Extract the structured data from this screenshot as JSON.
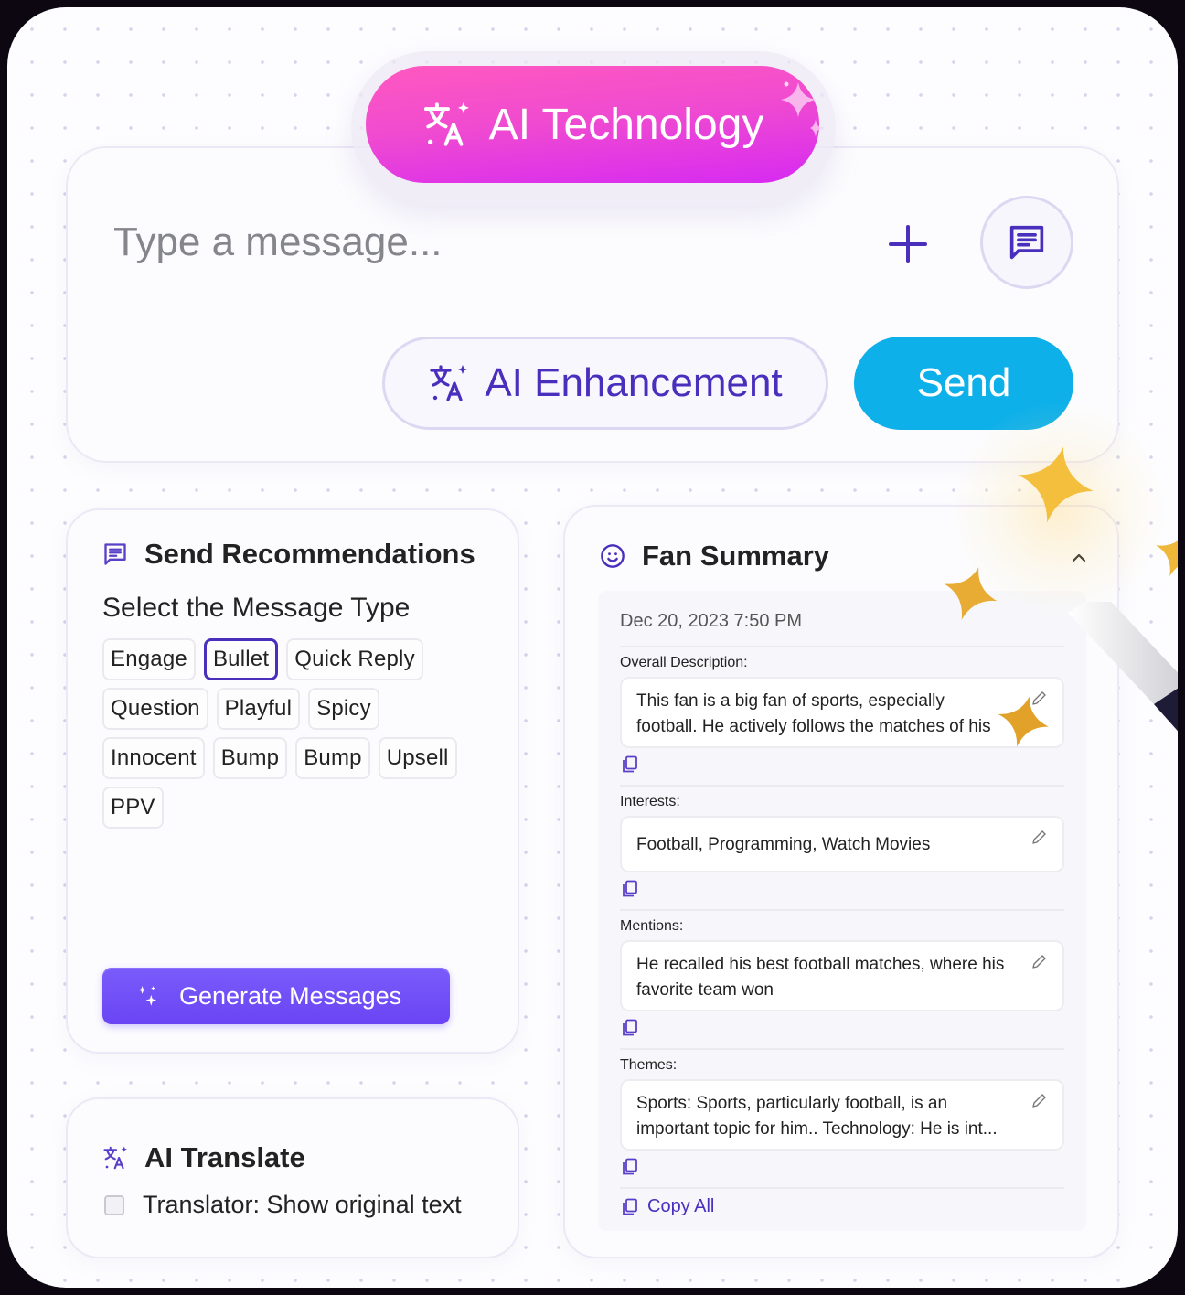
{
  "composer": {
    "placeholder": "Type a message...",
    "add_icon": "plus-icon",
    "message_icon": "chat-message-icon",
    "enhance_label": "AI Enhancement",
    "send_label": "Send"
  },
  "badge": {
    "label": "AI Technology",
    "icon": "translate-sparkle-icon",
    "gradient": [
      "#ff58c0",
      "#d62af2"
    ]
  },
  "recommendations": {
    "title": "Send Recommendations",
    "subtitle": "Select the Message Type",
    "chips": [
      {
        "label": "Engage",
        "selected": false
      },
      {
        "label": "Bullet",
        "selected": true
      },
      {
        "label": "Quick Reply",
        "selected": false
      },
      {
        "label": "Question",
        "selected": false
      },
      {
        "label": "Playful",
        "selected": false
      },
      {
        "label": "Spicy",
        "selected": false
      },
      {
        "label": "Innocent",
        "selected": false
      },
      {
        "label": "Bump",
        "selected": false
      },
      {
        "label": "Bump",
        "selected": false
      },
      {
        "label": "Upsell",
        "selected": false
      },
      {
        "label": "PPV",
        "selected": false
      }
    ],
    "generate_label": "Generate Messages"
  },
  "translate": {
    "title": "AI Translate",
    "checkbox_label": "Translator: Show original text",
    "checked": false
  },
  "fan_summary": {
    "title": "Fan Summary",
    "date": "Dec 20, 2023 7:50 PM",
    "fields": [
      {
        "label": "Overall Description:",
        "value": "This fan is a big fan of sports, especially football. He actively follows the matches of his"
      },
      {
        "label": "Interests:",
        "value": "Football, Programming, Watch Movies"
      },
      {
        "label": "Mentions:",
        "value": "He recalled his best football matches, where his favorite team won"
      },
      {
        "label": "Themes:",
        "value": "Sports: Sports, particularly football, is an important topic for him.. Technology: He is int..."
      }
    ],
    "copy_all_label": "Copy All"
  },
  "colors": {
    "accent": "#4a2fbd",
    "send": "#0eb0ea",
    "generate": "#6a44f4",
    "star": "#f0b83a"
  }
}
